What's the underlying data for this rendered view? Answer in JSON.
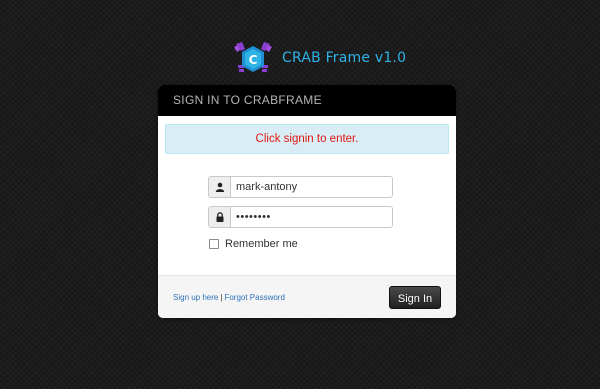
{
  "brand": {
    "title": "CRAB Frame v1.0",
    "logo_letter": "C",
    "logo_name": "crab-logo"
  },
  "panel": {
    "header_title": "SIGN IN TO CRABFRAME",
    "alert_text": "Click signin to enter."
  },
  "form": {
    "username_icon": "user-icon",
    "username_value": "mark-antony",
    "password_icon": "lock-icon",
    "password_value": "markbond",
    "remember_label": "Remember me",
    "remember_checked": false
  },
  "footer": {
    "signup_link": "Sign up here",
    "separator": "|",
    "forgot_link": "Forgot Password",
    "signin_button": "Sign In"
  },
  "colors": {
    "background": "#1c1c1c",
    "brand_text": "#2fb3e6",
    "alert_bg": "#d9edf7",
    "alert_text": "#e0180f",
    "link": "#2d72b8",
    "button": "#2b2b2b"
  }
}
